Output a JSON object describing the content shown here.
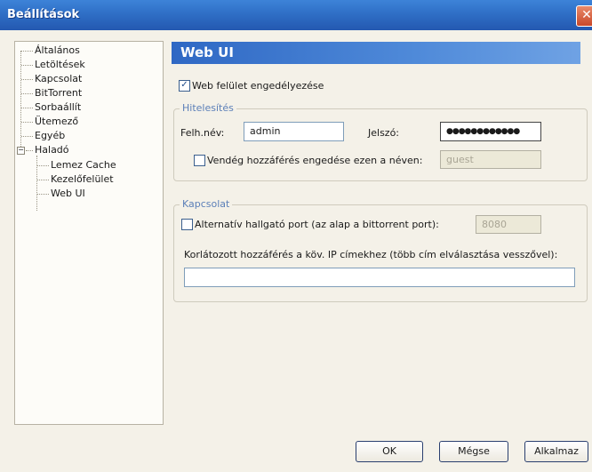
{
  "window": {
    "title": "Beállítások"
  },
  "tree": {
    "items": [
      "Általános",
      "Letöltések",
      "Kapcsolat",
      "BitTorrent",
      "Sorbaállít",
      "Ütemező",
      "Egyéb",
      "Haladó"
    ],
    "haladó_children": [
      "Lemez Cache",
      "Kezelőfelület",
      "Web UI"
    ],
    "selected": "Web UI"
  },
  "panel": {
    "title": "Web UI",
    "enable_label": "Web felület engedélyezése",
    "enable_checked": "✓",
    "auth": {
      "title": "Hitelesítés",
      "user_label": "Felh.név:",
      "user_value": "admin",
      "pass_label": "Jelszó:",
      "pass_value": "●●●●●●●●●●●●",
      "guest_label": "Vendég hozzáférés engedése ezen a néven:",
      "guest_value": "guest"
    },
    "conn": {
      "title": "Kapcsolat",
      "port_label": "Alternatív hallgató port (az alap a bittorrent port):",
      "port_value": "8080",
      "restrict_label": "Korlátozott hozzáférés a köv. IP címekhez (több cím elválasztása vesszővel):",
      "restrict_value": ""
    }
  },
  "buttons": {
    "ok": "OK",
    "cancel": "Mégse",
    "apply": "Alkalmaz"
  },
  "colors": {
    "titlebar": "#2f6fc6",
    "header": "#2f68c4",
    "groupTitle": "#5b7fb8"
  }
}
